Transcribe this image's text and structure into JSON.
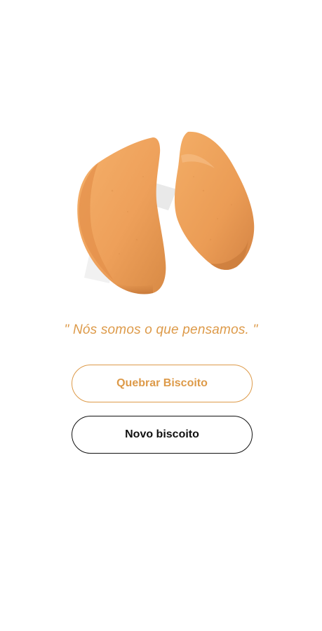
{
  "cookie": {
    "icon": "fortune-cookie-image"
  },
  "phrase": {
    "text": "\" Nós somos o que pensamos. \""
  },
  "buttons": {
    "break_label": "Quebrar Biscoito",
    "new_label": "Novo biscoito"
  },
  "colors": {
    "accent": "#dd9a49",
    "dark": "#111111",
    "background": "#ffffff"
  }
}
